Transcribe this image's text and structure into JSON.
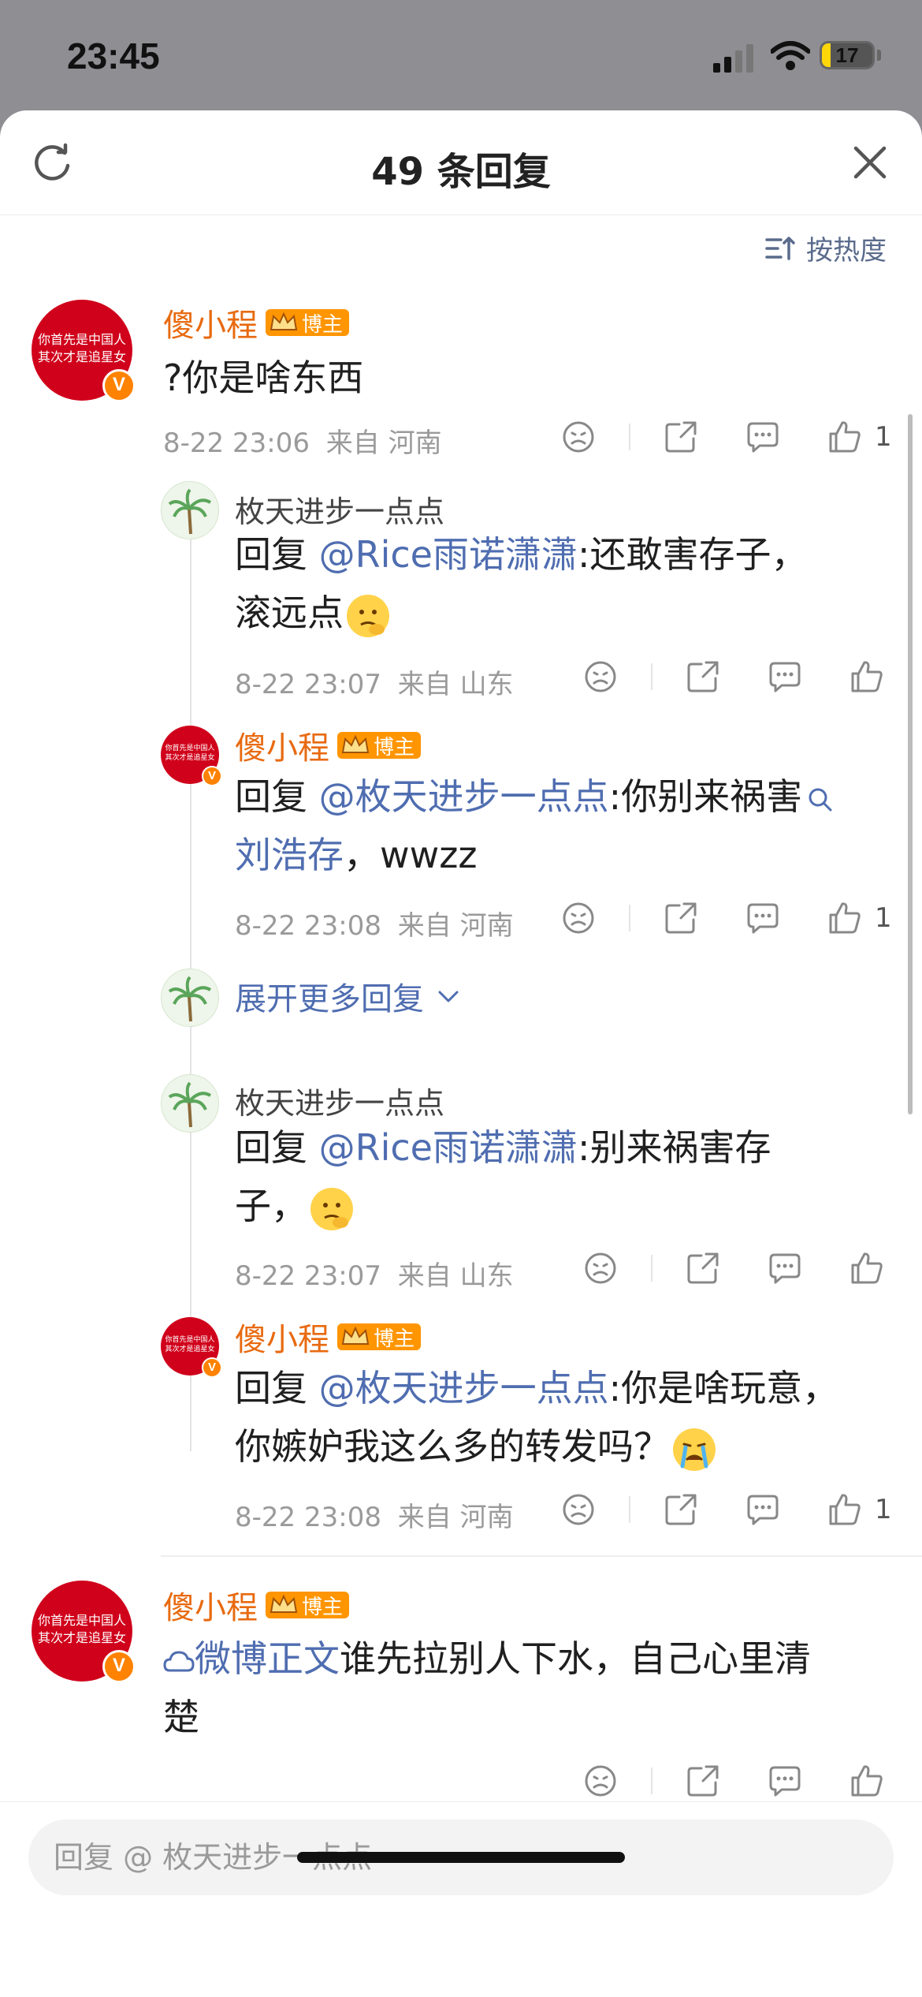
{
  "status_bar": {
    "time": "23:45",
    "battery": "17",
    "battery_fraction": 0.17
  },
  "header": {
    "title": "49 条回复"
  },
  "sort": {
    "label": "按热度"
  },
  "badge_label": "博主",
  "avatar_text": {
    "line1": "你首先是中国人",
    "line2": "其次才是追星女",
    "verified": "V"
  },
  "comments": [
    {
      "user": "傻小程",
      "text": "?你是啥东西",
      "time": "8-22 23:06",
      "location": "来自 河南",
      "likes": "1"
    },
    {
      "user": "枚天进步一点点",
      "reply_prefix": "回复 ",
      "mention": "@Rice雨诺潇潇",
      "text_line1": ":还敢害存子，",
      "text_line2": "滚远点",
      "time": "8-22 23:07",
      "location": "来自 山东"
    },
    {
      "user": "傻小程",
      "reply_prefix": "回复 ",
      "mention": "@枚天进步一点点",
      "text_line1": ":你别来祸害",
      "link": "刘浩存",
      "text_line2": "，wwzz",
      "time": "8-22 23:08",
      "location": "来自 河南",
      "likes": "1"
    },
    {
      "user": "枚天进步一点点",
      "reply_prefix": "回复 ",
      "mention": "@Rice雨诺潇潇",
      "text_line1": ":别来祸害存",
      "text_line2": "子，",
      "time": "8-22 23:07",
      "location": "来自 山东"
    },
    {
      "user": "傻小程",
      "reply_prefix": "回复 ",
      "mention": "@枚天进步一点点",
      "text_line1": ":你是啥玩意，",
      "text_line2": "你嫉妒我这么多的转发吗？",
      "time": "8-22 23:08",
      "location": "来自 河南",
      "likes": "1"
    },
    {
      "user": "傻小程",
      "link": "微博正文",
      "text_line1": "谁先拉别人下水，自己心里清",
      "text_line2": "楚"
    }
  ],
  "expand_more": "展开更多回复",
  "reply_input": {
    "placeholder": "回复 @ 枚天进步一点点"
  }
}
